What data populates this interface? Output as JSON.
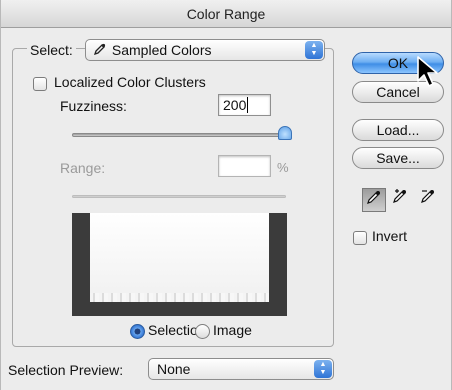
{
  "window": {
    "title": "Color Range"
  },
  "select": {
    "label": "Select:",
    "value": "Sampled Colors",
    "icon": "eyedropper-icon"
  },
  "localized": {
    "label": "Localized Color Clusters",
    "checked": false
  },
  "fuzziness": {
    "label": "Fuzziness:",
    "value": "200",
    "slider_fraction": 1.0
  },
  "range": {
    "label": "Range:",
    "value": "",
    "unit": "%",
    "enabled": false
  },
  "preview_mode": {
    "selected": "Selection",
    "options": [
      "Selection",
      "Image"
    ]
  },
  "selection_preview": {
    "label": "Selection Preview:",
    "value": "None"
  },
  "buttons": {
    "ok": "OK",
    "cancel": "Cancel",
    "load": "Load...",
    "save": "Save..."
  },
  "tools": [
    "eyedropper-icon",
    "eyedropper-plus-icon",
    "eyedropper-minus-icon"
  ],
  "invert": {
    "label": "Invert",
    "checked": false
  },
  "colors": {
    "accent": "#3f8ee6",
    "preview_background": "#3b3b3b"
  }
}
